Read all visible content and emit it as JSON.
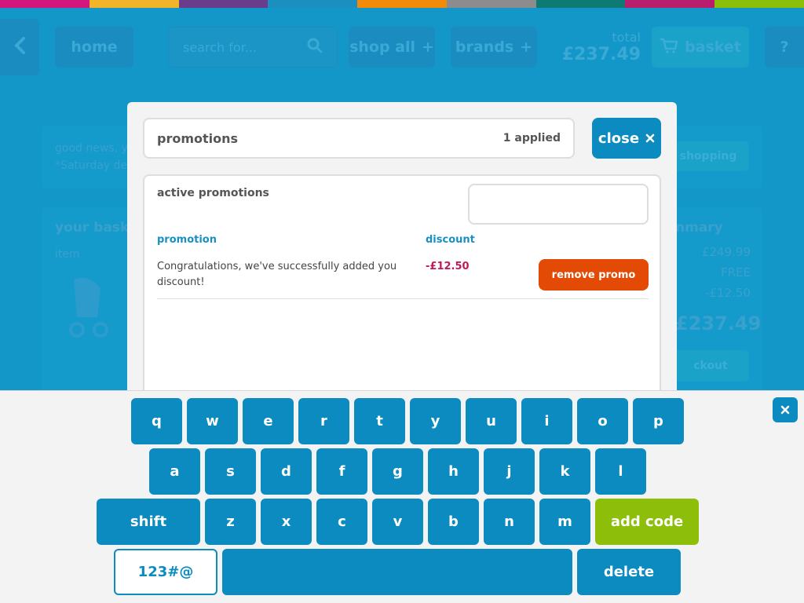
{
  "colors": {
    "stripes": [
      "#d4157e",
      "#f2b52a",
      "#6b3b8c",
      "#1a8fc0",
      "#f28a0a",
      "#8c8c8c",
      "#0d7a74",
      "#b81d6e",
      "#8dbf0a"
    ],
    "primary": "#0b8bbf",
    "orange": "#e24a05",
    "green": "#8dbf0a",
    "discount": "#c2185b"
  },
  "background": {
    "home": "home",
    "search_placeholder": "search for...",
    "shop_all": "shop all",
    "brands": "brands",
    "total_label": "total",
    "total_amount": "£237.49",
    "basket": "basket",
    "help": "?",
    "notice_line1": "good news, y",
    "notice_line2": "*Saturday de",
    "continue_shopping": "shopping",
    "your_basket": "your baske",
    "item_label": "item",
    "summary_title": "nmary",
    "summary_subtotal": "£249.99",
    "summary_delivery_label": "m",
    "summary_delivery": "FREE",
    "summary_discount": "-£12.50",
    "summary_total": "£237.49",
    "checkout": "ckout"
  },
  "modal": {
    "title": "promotions",
    "applied_count": "1 applied",
    "close": "close",
    "active_title": "active promotions",
    "code_input_value": "",
    "col_promotion": "promotion",
    "col_discount": "discount",
    "row": {
      "promotion": "Congratulations, we've successfully added you discount!",
      "discount": "-£12.50",
      "action": "remove promo"
    }
  },
  "keyboard": {
    "row1": [
      "q",
      "w",
      "e",
      "r",
      "t",
      "y",
      "u",
      "i",
      "o",
      "p"
    ],
    "row2": [
      "a",
      "s",
      "d",
      "f",
      "g",
      "h",
      "j",
      "k",
      "l"
    ],
    "row3": [
      "z",
      "x",
      "c",
      "v",
      "b",
      "n",
      "m"
    ],
    "shift": "shift",
    "add_code": "add code",
    "symbols": "123#@",
    "space": "",
    "delete": "delete"
  }
}
